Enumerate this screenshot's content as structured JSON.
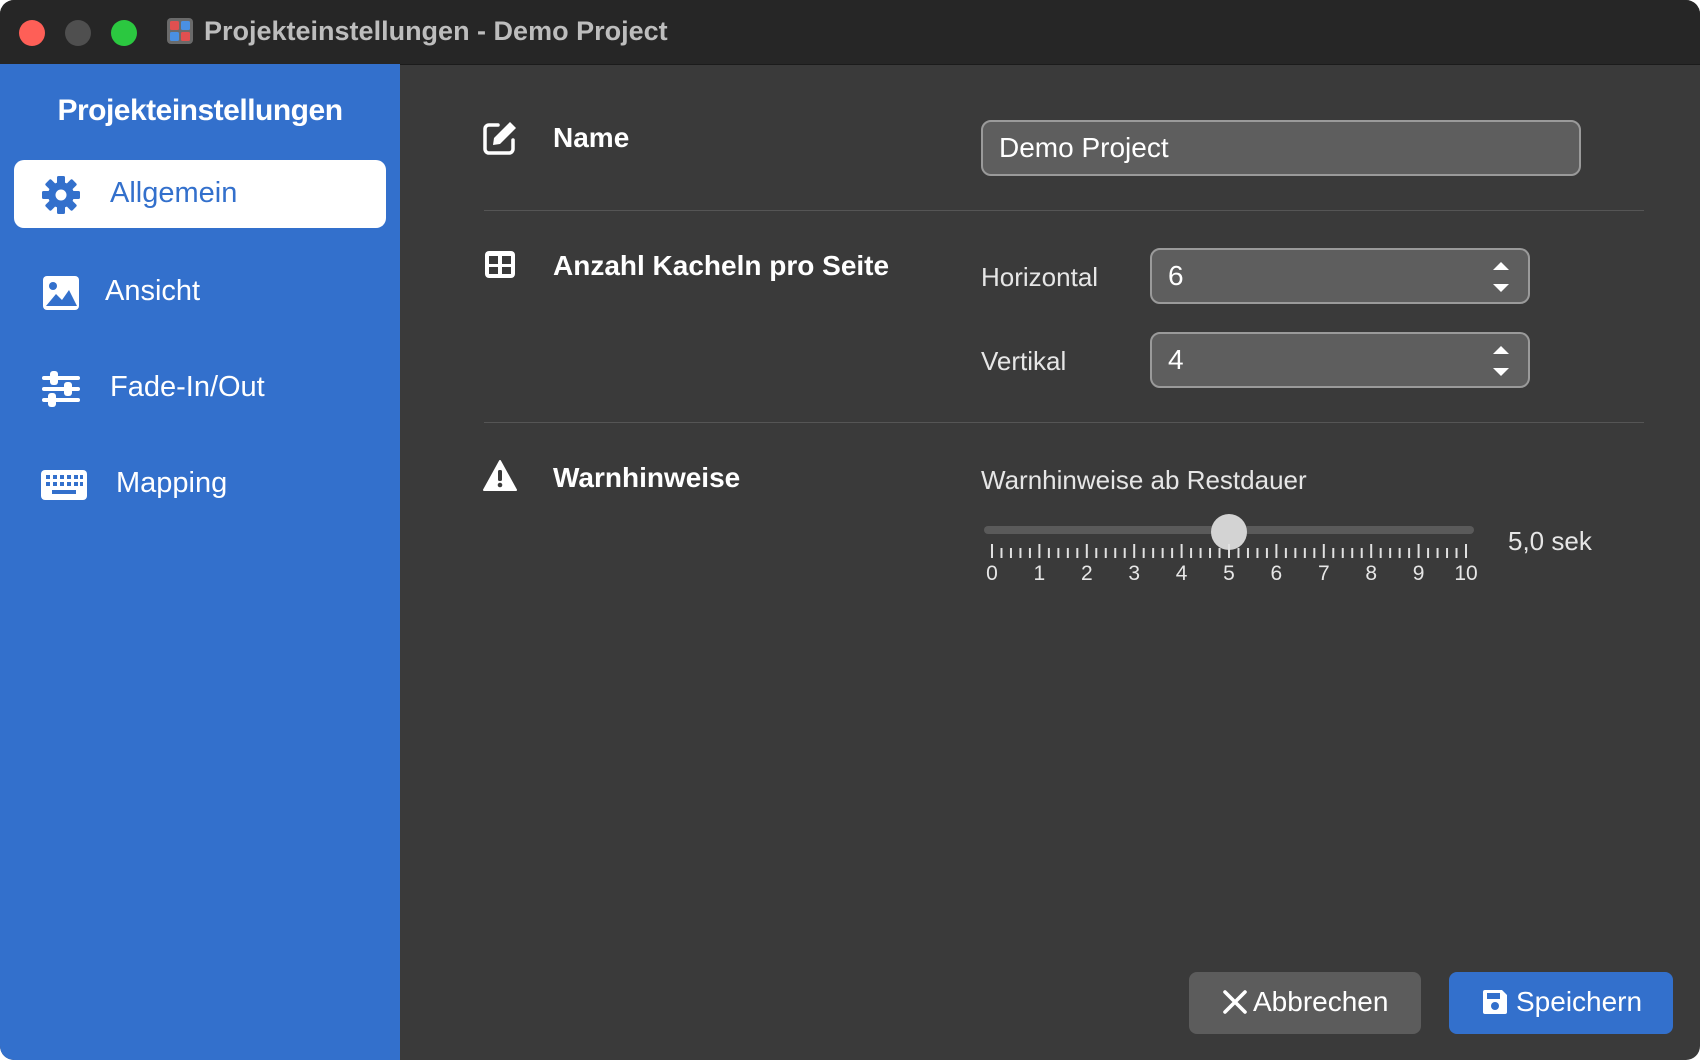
{
  "window": {
    "title": "Projekteinstellungen - Demo Project"
  },
  "sidebar": {
    "title": "Projekteinstellungen",
    "items": [
      {
        "label": "Allgemein",
        "icon": "gear-icon",
        "active": true
      },
      {
        "label": "Ansicht",
        "icon": "image-icon",
        "active": false
      },
      {
        "label": "Fade-In/Out",
        "icon": "sliders-icon",
        "active": false
      },
      {
        "label": "Mapping",
        "icon": "keyboard-icon",
        "active": false
      }
    ]
  },
  "general": {
    "name": {
      "label": "Name",
      "value": "Demo Project"
    },
    "tiles": {
      "label": "Anzahl Kacheln pro Seite",
      "horizontal_label": "Horizontal",
      "horizontal_value": "6",
      "vertical_label": "Vertikal",
      "vertical_value": "4"
    },
    "warnings": {
      "label": "Warnhinweise",
      "slider_label": "Warnhinweise ab Restdauer",
      "slider_min": 0,
      "slider_max": 10,
      "slider_value": 5,
      "value_text": "5,0 sek",
      "tick_labels": [
        "0",
        "1",
        "2",
        "3",
        "4",
        "5",
        "6",
        "7",
        "8",
        "9",
        "10"
      ]
    }
  },
  "footer": {
    "cancel_label": "Abbrechen",
    "save_label": "Speichern"
  },
  "colors": {
    "accent": "#3370cc",
    "content_bg": "#3a3a3a",
    "titlebar_bg": "#262626"
  }
}
